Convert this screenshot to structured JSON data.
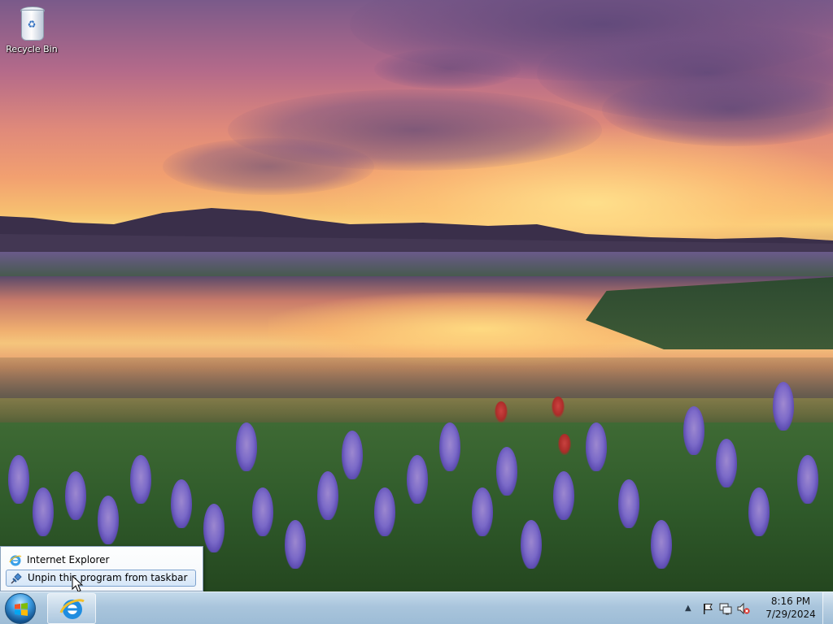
{
  "desktop": {
    "icons": [
      {
        "label": "Recycle Bin",
        "icon": "recycle-bin-icon"
      }
    ]
  },
  "jumplist": {
    "items": [
      {
        "label": "Internet Explorer",
        "icon": "internet-explorer-icon",
        "hovered": false
      },
      {
        "label": "Unpin this program from taskbar",
        "icon": "unpin-icon",
        "hovered": true
      }
    ]
  },
  "taskbar": {
    "start_icon": "windows-logo-icon",
    "pinned": [
      {
        "name": "Internet Explorer",
        "icon": "internet-explorer-icon"
      }
    ],
    "tray": {
      "chevron": "▲",
      "icons": [
        "action-center-flag-icon",
        "network-icon",
        "volume-muted-icon"
      ]
    },
    "clock": {
      "time": "8:16 PM",
      "date": "7/29/2024"
    }
  }
}
